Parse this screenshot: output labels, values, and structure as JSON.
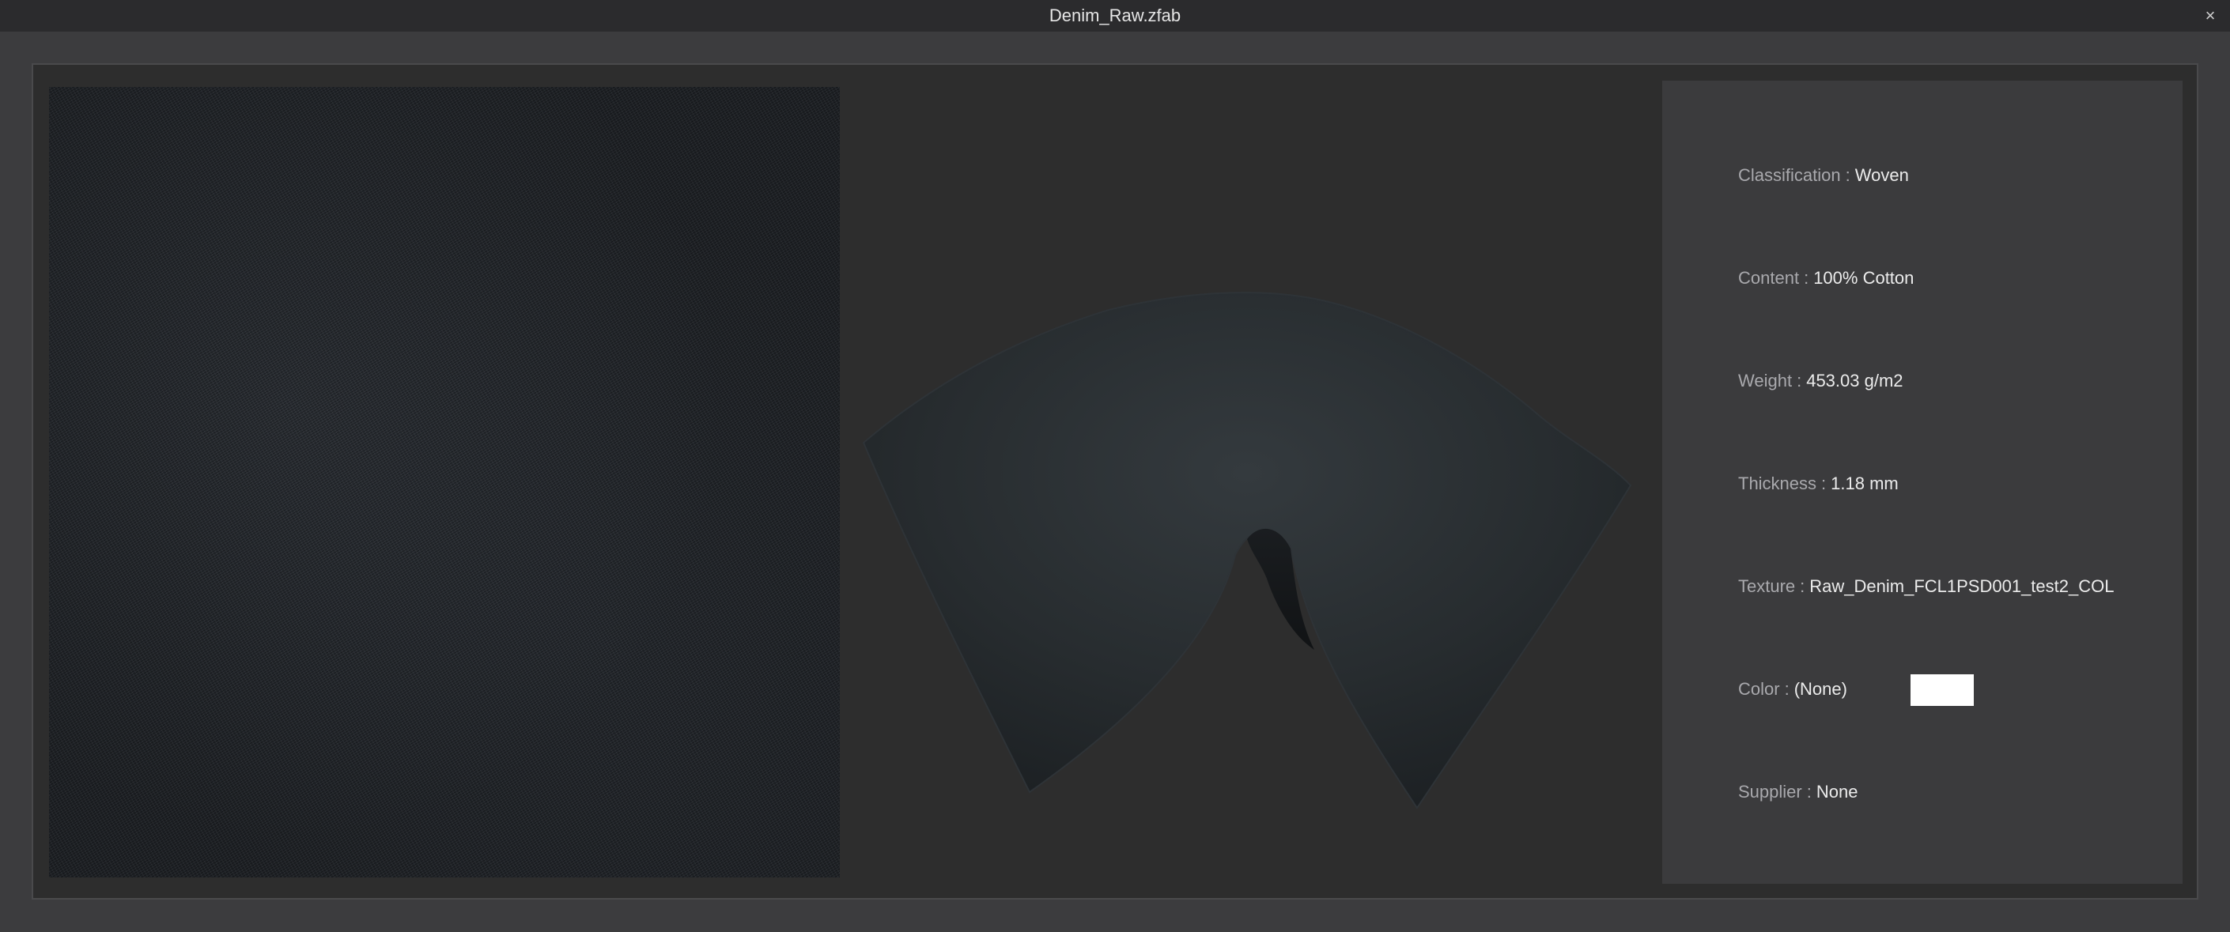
{
  "window": {
    "title": "Denim_Raw.zfab",
    "close_glyph": "×"
  },
  "properties": [
    {
      "label": "Classification",
      "value": "Woven"
    },
    {
      "label": "Content",
      "value": "100% Cotton"
    },
    {
      "label": "Weight",
      "value": "453.03 g/m2"
    },
    {
      "label": "Thickness",
      "value": "1.18 mm"
    },
    {
      "label": "Texture",
      "value": "Raw_Denim_FCL1PSD001_test2_COL"
    },
    {
      "label": "Color",
      "value": "(None)"
    },
    {
      "label": "Supplier",
      "value": "None"
    }
  ],
  "separator": ":",
  "colors": {
    "color_chip": "#ffffff",
    "fabric": "#2a2f33"
  }
}
